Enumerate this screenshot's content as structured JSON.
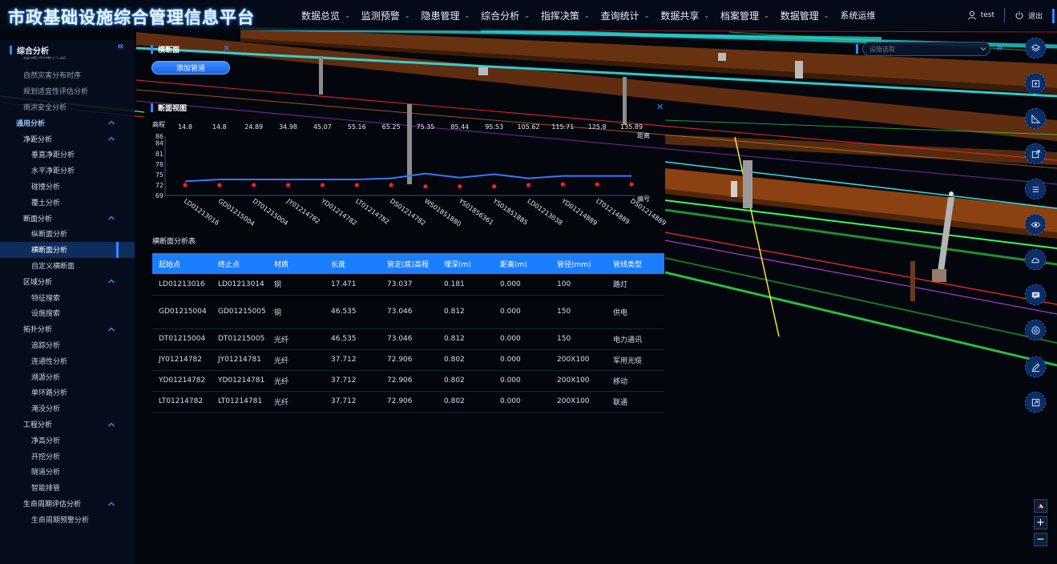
{
  "app": {
    "title": "市政基础设施综合管理信息平台"
  },
  "nav": [
    {
      "label": "数据总览",
      "has_menu": true
    },
    {
      "label": "监测预警",
      "has_menu": true
    },
    {
      "label": "隐患管理",
      "has_menu": true
    },
    {
      "label": "综合分析",
      "has_menu": true
    },
    {
      "label": "指挥决策",
      "has_menu": true
    },
    {
      "label": "查询统计",
      "has_menu": true
    },
    {
      "label": "数据共享",
      "has_menu": true
    },
    {
      "label": "档案管理",
      "has_menu": true
    },
    {
      "label": "数据管理",
      "has_menu": true
    },
    {
      "label": "系统运维",
      "has_menu": false
    }
  ],
  "user": {
    "name": "test",
    "logout": "退出"
  },
  "sidebar": {
    "title": "综合分析",
    "clipped_item": "地质灾害分析",
    "items": [
      {
        "label": "自然灾害分布时序",
        "level": 0,
        "type": "plain"
      },
      {
        "label": "规划适宜性评估分析",
        "level": 0,
        "type": "plain"
      },
      {
        "label": "雨洪安全分析",
        "level": 0,
        "type": "plain"
      },
      {
        "label": "通用分析",
        "level": 0,
        "type": "group"
      },
      {
        "label": "净距分析",
        "level": 1,
        "type": "group"
      },
      {
        "label": "垂直净距分析",
        "level": 2
      },
      {
        "label": "水平净距分析",
        "level": 2
      },
      {
        "label": "碰撞分析",
        "level": 2
      },
      {
        "label": "覆土分析",
        "level": 2
      },
      {
        "label": "断面分析",
        "level": 1,
        "type": "group"
      },
      {
        "label": "纵断面分析",
        "level": 2
      },
      {
        "label": "横断面分析",
        "level": 2,
        "active": true
      },
      {
        "label": "自定义横断面",
        "level": 2
      },
      {
        "label": "区域分析",
        "level": 1,
        "type": "group"
      },
      {
        "label": "特征搜索",
        "level": 2
      },
      {
        "label": "设施搜索",
        "level": 2
      },
      {
        "label": "拓扑分析",
        "level": 1,
        "type": "group"
      },
      {
        "label": "追踪分析",
        "level": 2
      },
      {
        "label": "连通性分析",
        "level": 2
      },
      {
        "label": "溯源分析",
        "level": 2
      },
      {
        "label": "单环路分析",
        "level": 2
      },
      {
        "label": "淹没分析",
        "level": 2
      },
      {
        "label": "工程分析",
        "level": 1,
        "type": "group"
      },
      {
        "label": "净高分析",
        "level": 2
      },
      {
        "label": "开挖分析",
        "level": 2
      },
      {
        "label": "隧道分析",
        "level": 2
      },
      {
        "label": "智能排管",
        "level": 2
      },
      {
        "label": "生命周期评估分析",
        "level": 1,
        "type": "group"
      },
      {
        "label": "生命周期预警分析",
        "level": 2
      }
    ]
  },
  "panel_a": {
    "title": "横断面",
    "add_button": "添加管道"
  },
  "panel_b": {
    "title": "断面视图",
    "table_title": "横断面分析表"
  },
  "chart_data": {
    "type": "line",
    "ylabel": "高程",
    "xlabel_top": "距离",
    "xlabel_bottom": "编号",
    "y_ticks": [
      69,
      72,
      75,
      78,
      81,
      84,
      86
    ],
    "ylim": [
      69,
      86
    ],
    "distances": [
      "14.8",
      "14.8",
      "24.89",
      "34.98",
      "45.07",
      "55.16",
      "65.25",
      "75.35",
      "85.44",
      "95.53",
      "105.62",
      "115.71",
      "125.8",
      "135.89"
    ],
    "codes": [
      "LD01213016",
      "GD01215004",
      "DT01215004",
      "JY01214782",
      "YD01214782",
      "LT01214782",
      "DS01214782",
      "WS01851880",
      "YS01856361",
      "YS01851885",
      "LD01213038",
      "YD01214889",
      "LT01214889",
      "DS01214889"
    ],
    "series": [
      {
        "name": "",
        "color": "#2f7bff",
        "values": [
          73.04,
          73.6,
          73.6,
          73.6,
          73.6,
          73.6,
          73.9,
          75.3,
          74.1,
          75.1,
          73.9,
          74.6,
          74.6,
          74.6
        ]
      },
      {
        "name": "",
        "color": "#ff2020",
        "values": [
          72.0,
          72.0,
          72.0,
          72.0,
          72.0,
          72.0,
          72.0,
          71.6,
          71.6,
          71.6,
          72.0,
          72.2,
          72.2,
          72.2
        ]
      }
    ],
    "grid": false
  },
  "table": {
    "headers": [
      "起始点",
      "终止点",
      "材质",
      "长度",
      "管定(底)高程",
      "埋深(m)",
      "距离(m)",
      "管径(mm)",
      "管线类型"
    ],
    "rows": [
      [
        "LD01213016",
        "LD01213014",
        "铜",
        "17.471",
        "73.037",
        "0.181",
        "0.000",
        "100",
        "路灯"
      ],
      [
        "GD01215004",
        "GD01215005",
        "铜",
        "46.535",
        "73.046",
        "0.812",
        "0.000",
        "150",
        "供电"
      ],
      [
        "DT01215004",
        "DT01215005",
        "光纤",
        "46.535",
        "73.046",
        "0.812",
        "0.000",
        "150",
        "电力通讯"
      ],
      [
        "JY01214782",
        "JY01214781",
        "光纤",
        "37.712",
        "72.906",
        "0.802",
        "0.000",
        "200X100",
        "军用光缆"
      ],
      [
        "YD01214782",
        "YD01214781",
        "光纤",
        "37.712",
        "72.906",
        "0.802",
        "0.000",
        "200X100",
        "移动"
      ],
      [
        "LT01214782",
        "LT01214781",
        "光纤",
        "37.712",
        "72.906",
        "0.802",
        "0.000",
        "200X100",
        "联通"
      ]
    ]
  },
  "search": {
    "placeholder": "设施选取"
  },
  "tools": [
    "layers-icon",
    "add-layer-icon",
    "measure-icon",
    "export-icon",
    "list-icon",
    "eye-icon",
    "cloud-icon",
    "message-icon",
    "compass-icon",
    "edit-icon",
    "fullscreen-icon"
  ],
  "zoom": {
    "in": "+",
    "out": "−"
  },
  "colors": {
    "accent": "#2f8bff",
    "header_row": "#1b7dff",
    "active_item": "#0e2c5c"
  }
}
